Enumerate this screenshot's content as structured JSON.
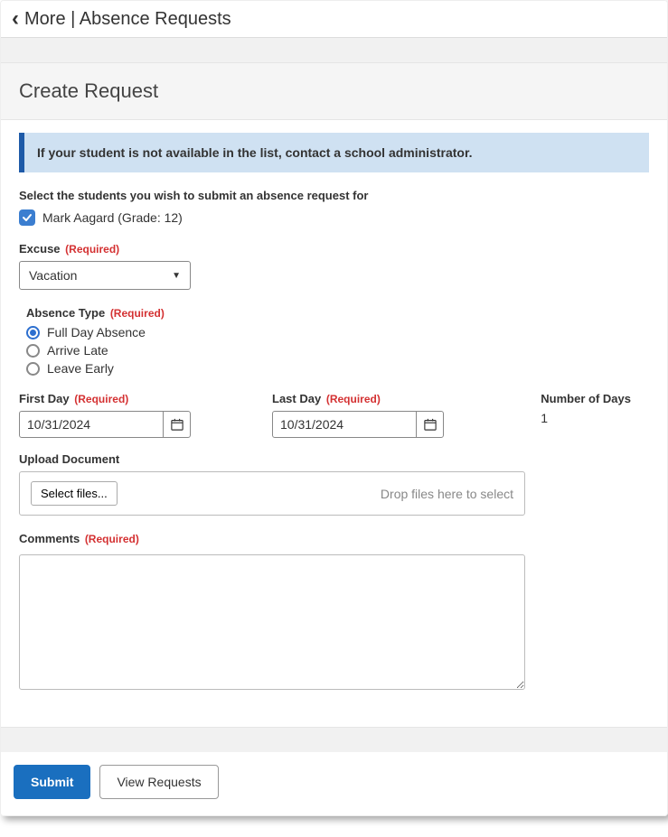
{
  "header": {
    "breadcrumb": "More | Absence Requests"
  },
  "section_title": "Create Request",
  "info_banner": "If your student is not available in the list, contact a school administrator.",
  "student_select": {
    "label": "Select the students you wish to submit an absence request for",
    "students": [
      {
        "name": "Mark Aagard (Grade: 12)",
        "checked": true
      }
    ]
  },
  "excuse": {
    "label": "Excuse",
    "required": "(Required)",
    "value": "Vacation"
  },
  "absence_type": {
    "label": "Absence Type",
    "required": "(Required)",
    "options": [
      {
        "label": "Full Day Absence",
        "selected": true
      },
      {
        "label": "Arrive Late",
        "selected": false
      },
      {
        "label": "Leave Early",
        "selected": false
      }
    ]
  },
  "first_day": {
    "label": "First Day",
    "required": "(Required)",
    "value": "10/31/2024"
  },
  "last_day": {
    "label": "Last Day",
    "required": "(Required)",
    "value": "10/31/2024"
  },
  "num_days": {
    "label": "Number of Days",
    "value": "1"
  },
  "upload": {
    "label": "Upload Document",
    "button": "Select files...",
    "hint": "Drop files here to select"
  },
  "comments": {
    "label": "Comments",
    "required": "(Required)",
    "value": ""
  },
  "footer": {
    "submit": "Submit",
    "view": "View Requests"
  }
}
